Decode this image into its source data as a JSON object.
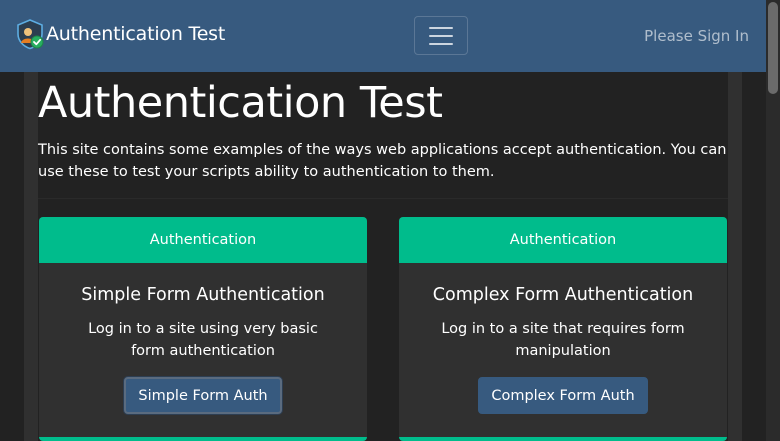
{
  "navbar": {
    "brand_text": "Authentication Test",
    "signin_label": "Please Sign In",
    "menu_icon": "hamburger-icon"
  },
  "page": {
    "title": "Authentication Test",
    "intro": "This site contains some examples of the ways web applications accept authentication. You can use these to test your scripts ability to authentication to them."
  },
  "cards": [
    {
      "header": "Authentication",
      "title": "Simple Form Authentication",
      "text": "Log in to a site using very basic form authentication",
      "button": "Simple Form Auth"
    },
    {
      "header": "Authentication",
      "title": "Complex Form Authentication",
      "text": "Log in to a site that requires form manipulation",
      "button": "Complex Form Auth"
    }
  ],
  "colors": {
    "navbar": "#375a7f",
    "card_header": "#00bc8c",
    "background": "#222222",
    "card_body": "#303030",
    "button": "#375a7f"
  }
}
